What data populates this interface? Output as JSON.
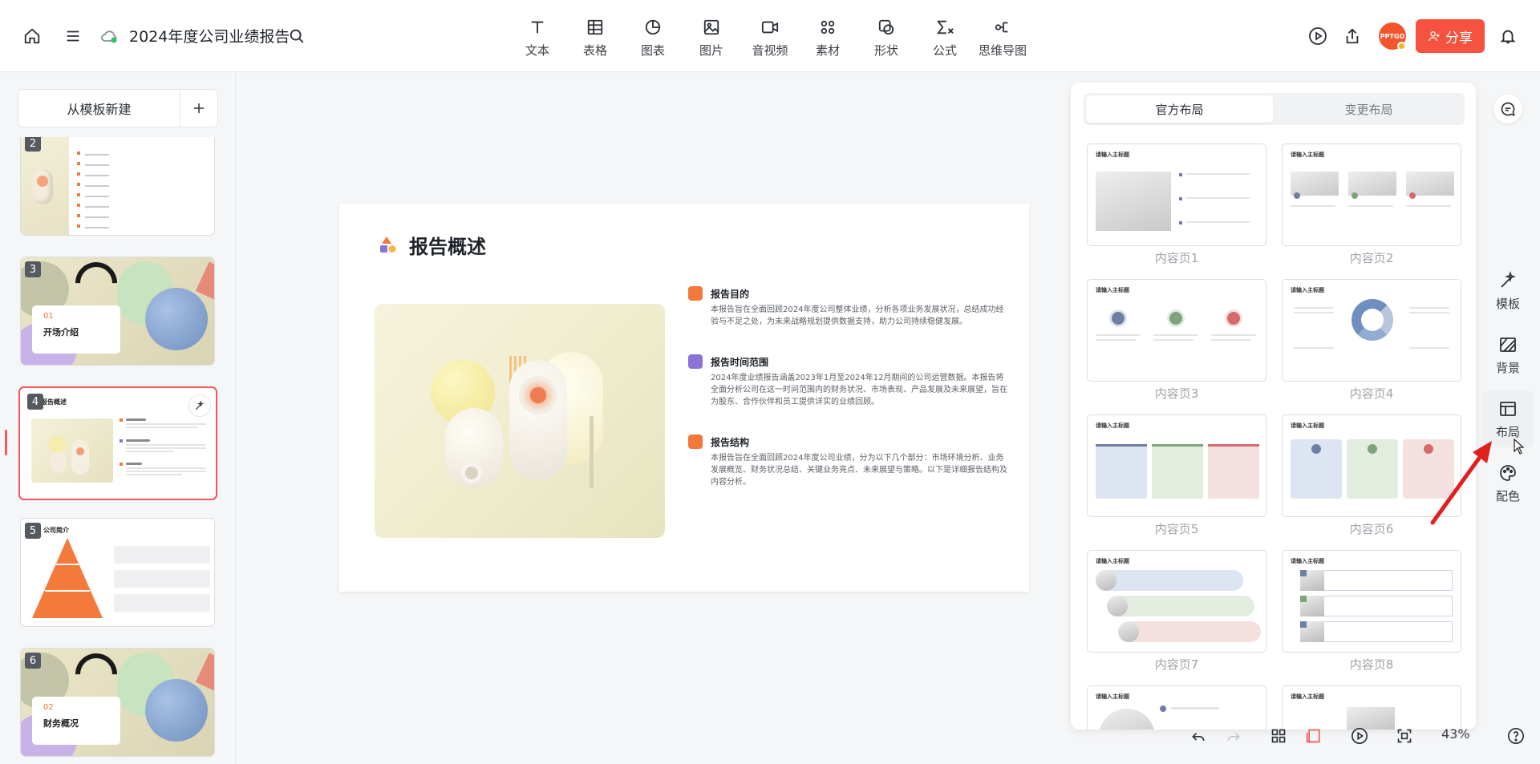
{
  "header": {
    "doc_title": "2024年度公司业绩报告",
    "avatar_text": "PPTGO",
    "share_label": "分享"
  },
  "toolbar": {
    "items": [
      {
        "label": "文本",
        "icon": "text-icon"
      },
      {
        "label": "表格",
        "icon": "table-icon"
      },
      {
        "label": "图表",
        "icon": "chart-icon"
      },
      {
        "label": "图片",
        "icon": "image-icon"
      },
      {
        "label": "音视频",
        "icon": "video-icon"
      },
      {
        "label": "素材",
        "icon": "material-icon"
      },
      {
        "label": "形状",
        "icon": "shape-icon"
      },
      {
        "label": "公式",
        "icon": "formula-icon"
      },
      {
        "label": "思维导图",
        "icon": "mindmap-icon"
      }
    ]
  },
  "left_panel": {
    "new_from_template": "从模板新建",
    "slides": [
      {
        "number": "2"
      },
      {
        "number": "3",
        "chapter": "01",
        "title": "开场介绍"
      },
      {
        "number": "4",
        "title": "报告概述"
      },
      {
        "number": "5",
        "title": "公司简介"
      },
      {
        "number": "6",
        "chapter": "02",
        "title": "财务概况"
      }
    ]
  },
  "slide": {
    "title": "报告概述",
    "sections": [
      {
        "title": "报告目的",
        "body": "本报告旨在全面回顾2024年度公司整体业绩，分析各项业务发展状况，总结成功经验与不足之处，为未来战略规划提供数据支持，助力公司持续稳健发展。",
        "color": "#f2793a"
      },
      {
        "title": "报告时间范围",
        "body": "2024年度业绩报告涵盖2023年1月至2024年12月期间的公司运营数据。本报告将全面分析公司在这一时间范围内的财务状况、市场表现、产品发展及未来展望，旨在为股东、合作伙伴和员工提供详实的业绩回顾。",
        "color": "#8b72d9"
      },
      {
        "title": "报告结构",
        "body": "本报告旨在全面回顾2024年度公司业绩，分为以下几个部分：市场环境分析、业务发展概览、财务状况总结、关键业务亮点、未来展望与策略。以下是详细报告结构及内容分析。",
        "color": "#f2793a"
      }
    ]
  },
  "layout_panel": {
    "tabs": [
      "官方布局",
      "变更布局"
    ],
    "selected_tab": 0,
    "mini_title": "请输入主标题",
    "layouts": [
      "内容页1",
      "内容页2",
      "内容页3",
      "内容页4",
      "内容页5",
      "内容页6",
      "内容页7",
      "内容页8",
      "",
      ""
    ]
  },
  "right_rail": {
    "items": [
      {
        "label": "模板",
        "icon": "template-icon"
      },
      {
        "label": "背景",
        "icon": "background-icon"
      },
      {
        "label": "布局",
        "icon": "layout-icon"
      },
      {
        "label": "配色",
        "icon": "palette-icon"
      }
    ],
    "selected": "布局"
  },
  "bottom": {
    "zoom": "43%"
  },
  "colors": {
    "accent": "#f5523f",
    "slide_active_border": "#f05a5a"
  }
}
